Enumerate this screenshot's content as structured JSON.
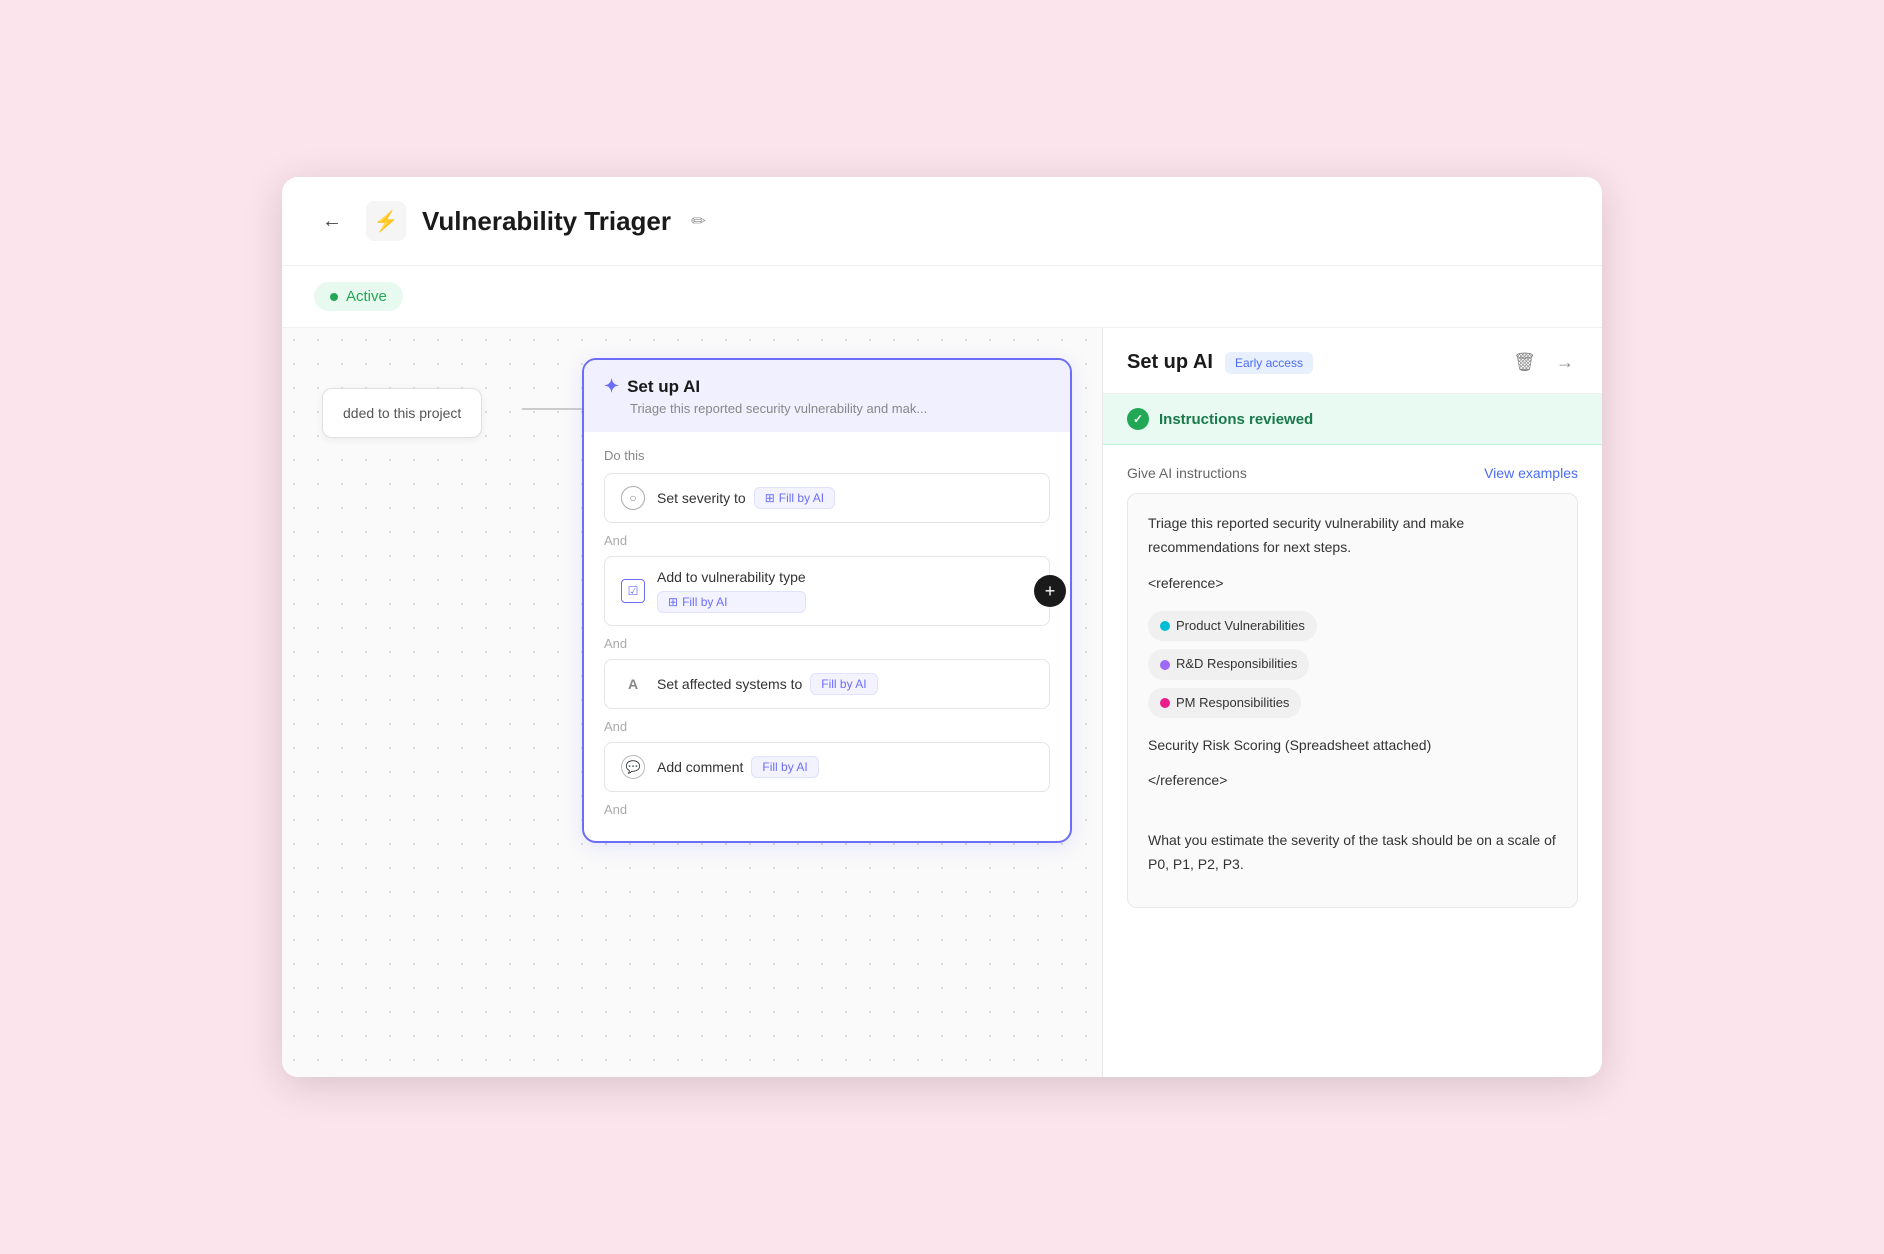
{
  "header": {
    "back_label": "←",
    "icon_symbol": "⚡",
    "title": "Vulnerability Triager",
    "edit_icon": "✏️"
  },
  "status": {
    "active_label": "Active"
  },
  "canvas": {
    "trigger_node_text": "dded to this project",
    "ai_step": {
      "title": "Set up AI",
      "subtitle": "Triage this reported security vulnerability and mak...",
      "do_this_label": "Do this",
      "actions": [
        {
          "icon_type": "circle",
          "text": "Set severity to",
          "badge": "Fill by AI"
        },
        {
          "icon_type": "checkbox",
          "text": "Add to vulnerability type",
          "badge": "Fill by AI"
        },
        {
          "icon_type": "text-a",
          "text": "Set affected systems to",
          "badge": "Fill by AI"
        },
        {
          "icon_type": "comment",
          "text": "Add comment",
          "badge": "Fill by AI"
        }
      ],
      "and_label": "And",
      "add_button": "+"
    }
  },
  "right_panel": {
    "title": "Set up AI",
    "early_access_label": "Early access",
    "delete_icon": "🗑",
    "forward_icon": "→",
    "instructions_reviewed_label": "Instructions reviewed",
    "give_ai_instructions_label": "Give AI instructions",
    "view_examples_label": "View examples",
    "instructions_text_1": "Triage this reported security vulnerability and make recommendations for next steps.",
    "instructions_text_2": "<reference>",
    "labels": [
      {
        "text": "Product Vulnerabilities",
        "color_class": "dot-teal"
      },
      {
        "text": "R&D Responsibilities",
        "color_class": "dot-purple"
      },
      {
        "text": "PM Responsibilities",
        "color_class": "dot-pink"
      }
    ],
    "instructions_text_3": "Security Risk Scoring (Spreadsheet attached)",
    "instructions_text_4": "</reference>",
    "instructions_text_5": "What you estimate the severity of the task should be on a scale of P0, P1, P2, P3."
  }
}
